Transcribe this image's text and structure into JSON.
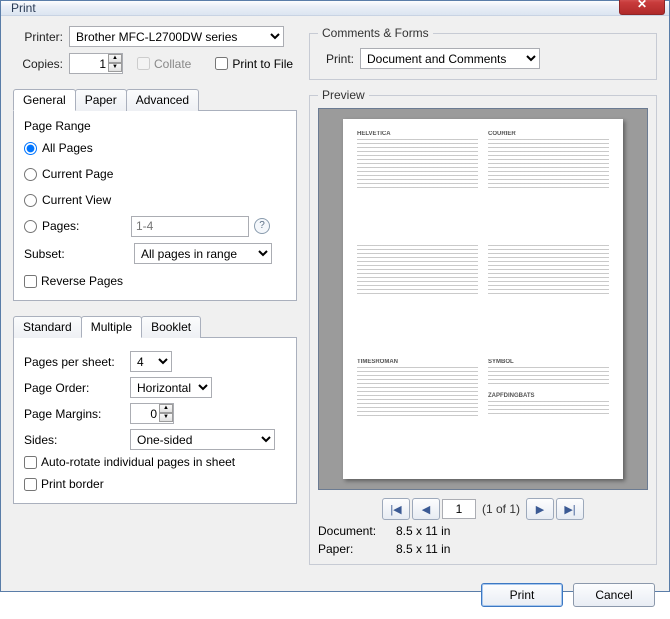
{
  "window": {
    "title": "Print"
  },
  "printer": {
    "label": "Printer:",
    "selected": "Brother MFC-L2700DW series",
    "copies_label": "Copies:",
    "copies_value": "1",
    "collate_label": "Collate",
    "print_to_file_label": "Print to File"
  },
  "tabs_main": {
    "general": "General",
    "paper": "Paper",
    "advanced": "Advanced"
  },
  "page_range": {
    "group_label": "Page Range",
    "all_pages": "All Pages",
    "current_page": "Current Page",
    "current_view": "Current View",
    "pages_label": "Pages:",
    "pages_placeholder": "1-4",
    "subset_label": "Subset:",
    "subset_selected": "All pages in range",
    "reverse_pages": "Reverse Pages"
  },
  "tabs_layout": {
    "standard": "Standard",
    "multiple": "Multiple",
    "booklet": "Booklet"
  },
  "multiple": {
    "pages_per_sheet_label": "Pages per sheet:",
    "pages_per_sheet_value": "4",
    "page_order_label": "Page Order:",
    "page_order_value": "Horizontal",
    "page_margins_label": "Page Margins:",
    "page_margins_value": "0",
    "sides_label": "Sides:",
    "sides_value": "One-sided",
    "auto_rotate": "Auto-rotate individual pages in sheet",
    "print_border": "Print border"
  },
  "comments_forms": {
    "group_label": "Comments & Forms",
    "print_label": "Print:",
    "selected": "Document and Comments"
  },
  "preview": {
    "group_label": "Preview",
    "page_current": "1",
    "page_total": "(1 of 1)",
    "document_label": "Document:",
    "document_value": "8.5 x 11 in",
    "paper_label": "Paper:",
    "paper_value": "8.5 x 11 in",
    "mini_titles": [
      "HELVETICA",
      "COURIER",
      "",
      "",
      "TIMESROMAN",
      "SYMBOL",
      "",
      "ZAPFDINGBATS"
    ]
  },
  "buttons": {
    "print": "Print",
    "cancel": "Cancel"
  },
  "icons": {
    "close": "✕",
    "help": "?",
    "first": "|◀",
    "prev": "◀",
    "next": "▶",
    "last": "▶|"
  }
}
